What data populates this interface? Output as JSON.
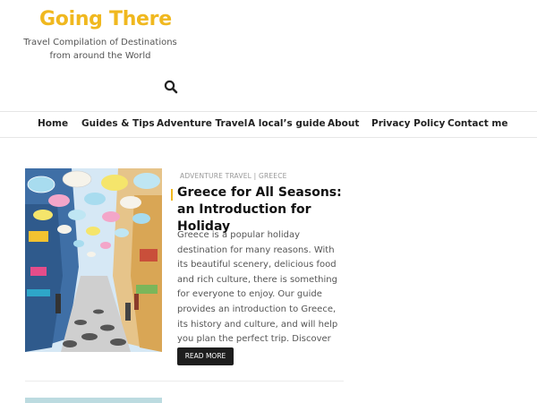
{
  "site": {
    "title": "Going There",
    "tagline": "Travel Compilation of Destinations from around the World"
  },
  "search": {
    "icon": "search-icon"
  },
  "nav": {
    "items": [
      {
        "label": "Home"
      },
      {
        "label": "Guides & Tips"
      },
      {
        "label": "Adventure Travel"
      },
      {
        "label": "A local’s guide"
      },
      {
        "label": "About"
      },
      {
        "label": "Privacy Policy"
      },
      {
        "label": "Contact me"
      }
    ]
  },
  "post": {
    "categories": "ADVENTURE TRAVEL | GREECE",
    "title": "Greece for All Seasons: an Introduction for Holiday",
    "excerpt": "Greece is a popular holiday destination for many reasons. With its beautiful scenery, delicious food and rich culture, there is something for everyone to enjoy. Our guide provides an introduction to Greece, its history and culture, and will help you plan the perfect trip. Discover more now.",
    "read_more": "READ MORE"
  },
  "colors": {
    "accent": "#f0b81f",
    "button_bg": "#1e1e1e"
  }
}
